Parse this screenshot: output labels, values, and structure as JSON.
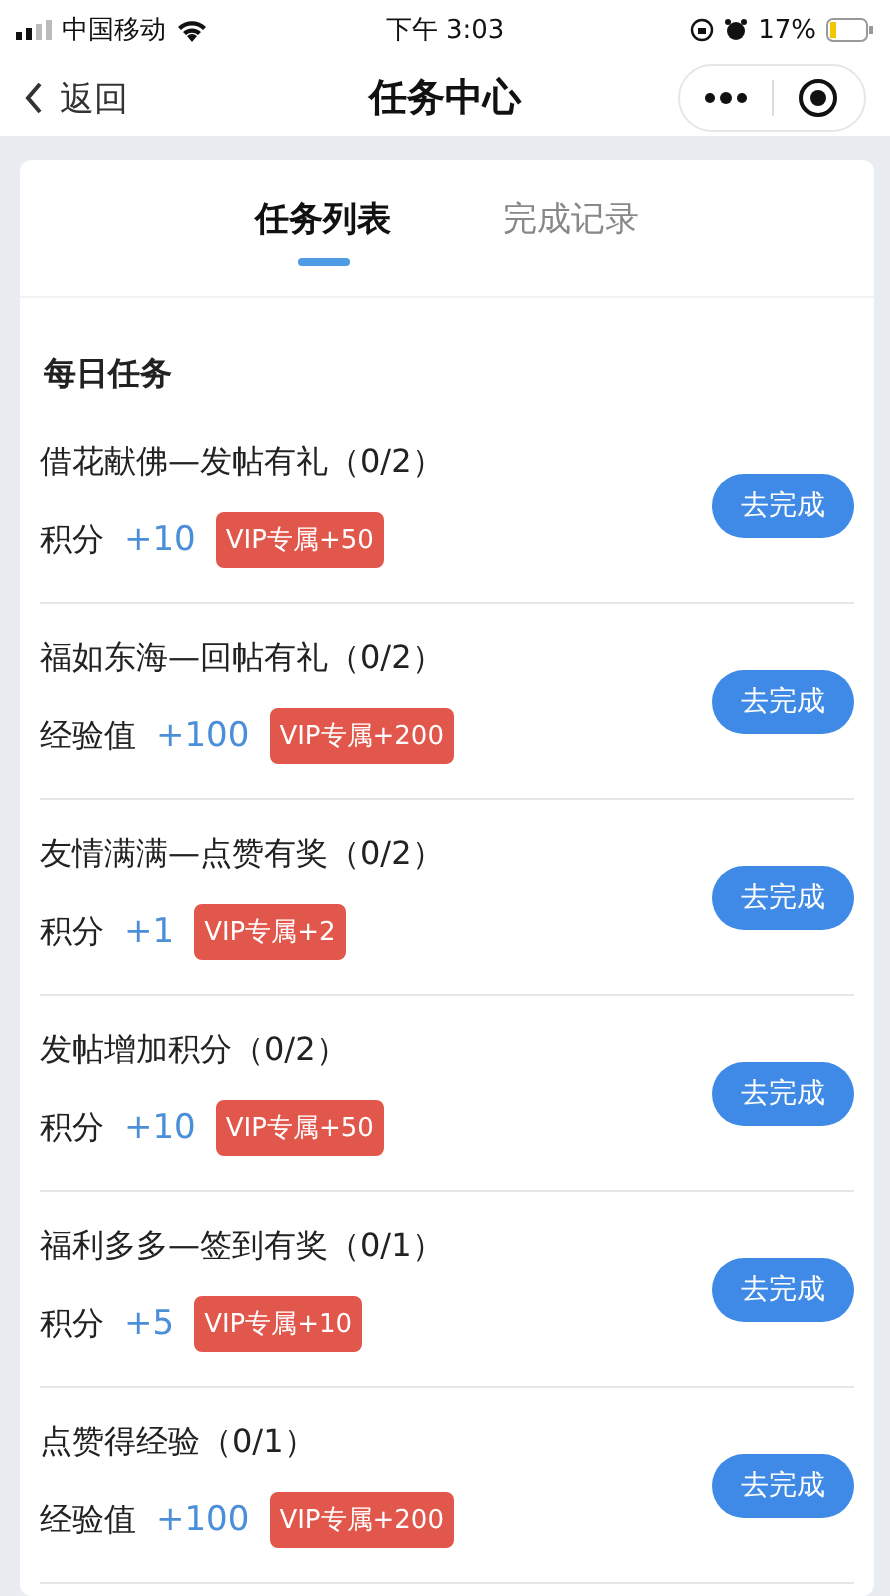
{
  "status_bar": {
    "carrier": "中国移动",
    "time": "下午 3:03",
    "battery": "17%"
  },
  "nav": {
    "back": "返回",
    "title": "任务中心"
  },
  "tabs": [
    {
      "label": "任务列表",
      "selected": true
    },
    {
      "label": "完成记录",
      "selected": false
    }
  ],
  "section_title": "每日任务",
  "tasks": [
    {
      "title": "借花献佛—发帖有礼（0/2）",
      "reward_label": "积分",
      "reward": "+10",
      "vip": "VIP专属+50",
      "action": "去完成"
    },
    {
      "title": "福如东海—回帖有礼（0/2）",
      "reward_label": "经验值",
      "reward": "+100",
      "vip": "VIP专属+200",
      "action": "去完成"
    },
    {
      "title": "友情满满—点赞有奖（0/2）",
      "reward_label": "积分",
      "reward": "+1",
      "vip": "VIP专属+2",
      "action": "去完成"
    },
    {
      "title": "发帖增加积分（0/2）",
      "reward_label": "积分",
      "reward": "+10",
      "vip": "VIP专属+50",
      "action": "去完成"
    },
    {
      "title": "福利多多—签到有奖（0/1）",
      "reward_label": "积分",
      "reward": "+5",
      "vip": "VIP专属+10",
      "action": "去完成"
    },
    {
      "title": "点赞得经验（0/1）",
      "reward_label": "经验值",
      "reward": "+100",
      "vip": "VIP专属+200",
      "action": "去完成"
    }
  ]
}
